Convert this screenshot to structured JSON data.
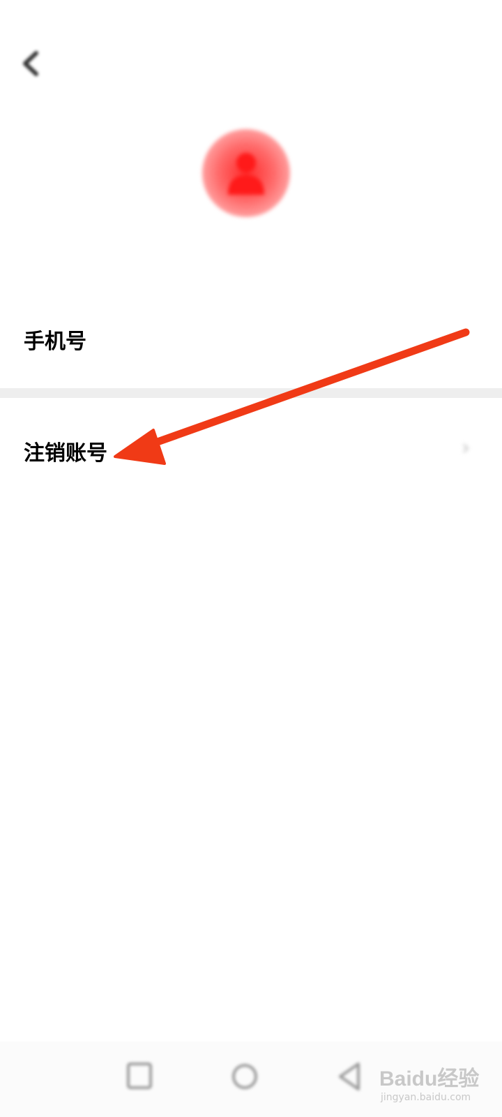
{
  "status_bar": {
    "time": "",
    "icons": ""
  },
  "header": {
    "title": ""
  },
  "profile": {
    "avatar_caption": ""
  },
  "rows": [
    {
      "label": "手机号",
      "value": ""
    },
    {
      "label": "注销账号"
    }
  ],
  "watermark": {
    "brand": "Baidu经验",
    "url": "jingyan.baidu.com"
  },
  "colors": {
    "accent": "#ff2a2a",
    "annotation_arrow": "#f03a16",
    "divider": "#eeeeee"
  },
  "icons": [
    "back-arrow-icon",
    "user-icon",
    "chevron-right-icon",
    "recent-apps-icon",
    "home-icon",
    "back-triangle-icon"
  ]
}
